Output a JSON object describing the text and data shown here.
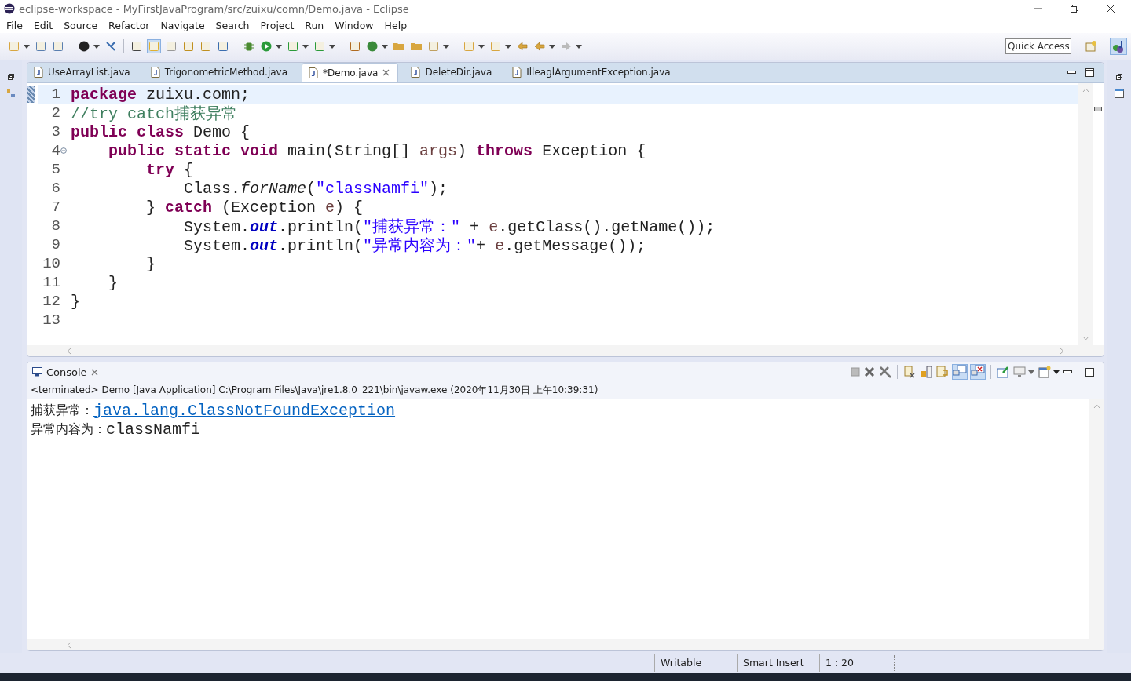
{
  "window": {
    "title": "eclipse-workspace - MyFirstJavaProgram/src/zuixu/comn/Demo.java - Eclipse"
  },
  "menu": [
    "File",
    "Edit",
    "Source",
    "Refactor",
    "Navigate",
    "Search",
    "Project",
    "Run",
    "Window",
    "Help"
  ],
  "quick_access": {
    "placeholder": "Quick Access"
  },
  "editor_tabs": [
    {
      "label": "UseArrayList.java",
      "selected": false
    },
    {
      "label": "TrigonometricMethod.java",
      "selected": false
    },
    {
      "label": "*Demo.java",
      "selected": true
    },
    {
      "label": "DeleteDir.java",
      "selected": false
    },
    {
      "label": "IlleaglArgumentException.java",
      "selected": false
    }
  ],
  "code_lines": [
    {
      "number": "1",
      "current": true,
      "foldable": false,
      "tokens": [
        {
          "kind": "kw",
          "text": "package"
        },
        {
          "kind": "plain",
          "text": " zuixu.comn;"
        }
      ]
    },
    {
      "number": "2",
      "current": false,
      "foldable": false,
      "tokens": [
        {
          "kind": "comment",
          "text": "//try catch捕获异常"
        }
      ]
    },
    {
      "number": "3",
      "current": false,
      "foldable": false,
      "tokens": [
        {
          "kind": "kw",
          "text": "public class"
        },
        {
          "kind": "plain",
          "text": " Demo {"
        }
      ]
    },
    {
      "number": "4",
      "current": false,
      "foldable": true,
      "tokens": [
        {
          "kind": "kw",
          "text": "    public static void"
        },
        {
          "kind": "plain",
          "text": " main(String[] "
        },
        {
          "kind": "param",
          "text": "args"
        },
        {
          "kind": "plain",
          "text": ") "
        },
        {
          "kind": "kw",
          "text": "throws"
        },
        {
          "kind": "plain",
          "text": " Exception {"
        }
      ]
    },
    {
      "number": "5",
      "current": false,
      "foldable": false,
      "tokens": [
        {
          "kind": "kw",
          "text": "        try"
        },
        {
          "kind": "plain",
          "text": " {"
        }
      ]
    },
    {
      "number": "6",
      "current": false,
      "foldable": false,
      "tokens": [
        {
          "kind": "plain",
          "text": "            Class."
        },
        {
          "kind": "static",
          "text": "forName"
        },
        {
          "kind": "plain",
          "text": "("
        },
        {
          "kind": "str",
          "text": "\"classNamfi\""
        },
        {
          "kind": "plain",
          "text": ");"
        }
      ]
    },
    {
      "number": "7",
      "current": false,
      "foldable": false,
      "tokens": [
        {
          "kind": "plain",
          "text": "        } "
        },
        {
          "kind": "kw",
          "text": "catch"
        },
        {
          "kind": "plain",
          "text": " (Exception "
        },
        {
          "kind": "param",
          "text": "e"
        },
        {
          "kind": "plain",
          "text": ") {"
        }
      ]
    },
    {
      "number": "8",
      "current": false,
      "foldable": false,
      "tokens": [
        {
          "kind": "plain",
          "text": "            System."
        },
        {
          "kind": "field",
          "text": "out"
        },
        {
          "kind": "plain",
          "text": ".println("
        },
        {
          "kind": "str",
          "text": "\"捕获异常：\""
        },
        {
          "kind": "plain",
          "text": " + "
        },
        {
          "kind": "param",
          "text": "e"
        },
        {
          "kind": "plain",
          "text": ".getClass().getName());"
        }
      ]
    },
    {
      "number": "9",
      "current": false,
      "foldable": false,
      "tokens": [
        {
          "kind": "plain",
          "text": "            System."
        },
        {
          "kind": "field",
          "text": "out"
        },
        {
          "kind": "plain",
          "text": ".println("
        },
        {
          "kind": "str",
          "text": "\"异常内容为：\""
        },
        {
          "kind": "plain",
          "text": "+ "
        },
        {
          "kind": "param",
          "text": "e"
        },
        {
          "kind": "plain",
          "text": ".getMessage());"
        }
      ]
    },
    {
      "number": "10",
      "current": false,
      "foldable": false,
      "tokens": [
        {
          "kind": "plain",
          "text": "        }"
        }
      ]
    },
    {
      "number": "11",
      "current": false,
      "foldable": false,
      "tokens": [
        {
          "kind": "plain",
          "text": "    }"
        }
      ]
    },
    {
      "number": "12",
      "current": false,
      "foldable": false,
      "tokens": [
        {
          "kind": "plain",
          "text": "}"
        }
      ]
    },
    {
      "number": "13",
      "current": false,
      "foldable": false
    }
  ],
  "console": {
    "tab": "Console",
    "header": "<terminated> Demo [Java Application] C:\\Program Files\\Java\\jre1.8.0_221\\bin\\javaw.exe (2020年11月30日 上午10:39:31)",
    "lines": [
      [
        {
          "kind": "plain",
          "text": "捕获异常："
        },
        {
          "kind": "link",
          "text": "java.lang.ClassNotFoundException"
        }
      ],
      [
        {
          "kind": "plain",
          "text": "异常内容为："
        },
        {
          "kind": "mono",
          "text": "classNamfi"
        }
      ]
    ]
  },
  "status_bar": [
    "Writable",
    "Smart Insert",
    "1 : 20"
  ]
}
